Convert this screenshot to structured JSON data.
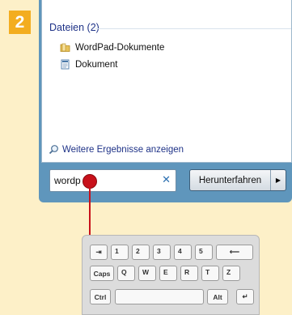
{
  "badge": "2",
  "results": {
    "category": "Dateien (2)",
    "items": [
      {
        "label": "WordPad-Dokumente",
        "icon": "folder-icon"
      },
      {
        "label": "Dokument",
        "icon": "wordpad-document-icon"
      }
    ],
    "more_link": "Weitere Ergebnisse anzeigen"
  },
  "search": {
    "value": "wordp",
    "clear_symbol": "✕"
  },
  "shutdown": {
    "label": "Herunterfahren",
    "arrow": "▶"
  },
  "keyboard": {
    "row1": [
      "1",
      "2",
      "3",
      "4",
      "5"
    ],
    "row2": [
      "Caps",
      "Q",
      "W",
      "E",
      "R",
      "T",
      "Z"
    ],
    "row3": [
      "Ctrl",
      "Alt"
    ],
    "tab_symbol": "⇥",
    "backspace_symbol": "⟵",
    "enter_symbol": "↵"
  },
  "colors": {
    "accent_badge": "#f3ad1f",
    "pointer": "#c8111b",
    "window_frame": "#5f96bc"
  }
}
